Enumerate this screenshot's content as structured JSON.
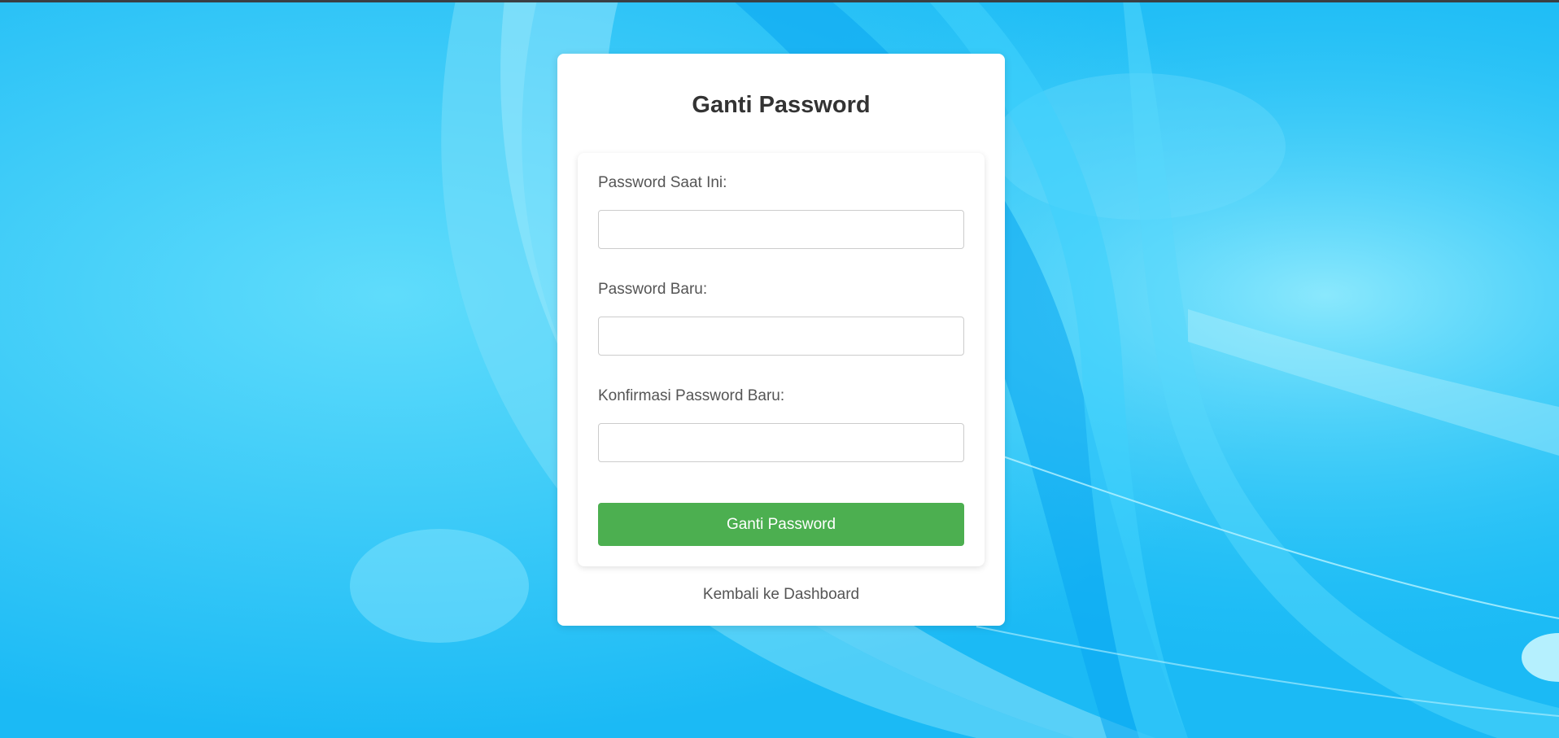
{
  "page": {
    "title": "Ganti Password",
    "background_color": "#22c4f7",
    "card_color": "#ffffff"
  },
  "form": {
    "current_password": {
      "label": "Password Saat Ini:",
      "value": "",
      "placeholder": ""
    },
    "new_password": {
      "label": "Password Baru:",
      "value": "",
      "placeholder": ""
    },
    "confirm_password": {
      "label": "Konfirmasi Password Baru:",
      "value": "",
      "placeholder": ""
    },
    "submit_label": "Ganti Password",
    "submit_color": "#4caf50"
  },
  "back_link": {
    "label": "Kembali ke Dashboard"
  }
}
